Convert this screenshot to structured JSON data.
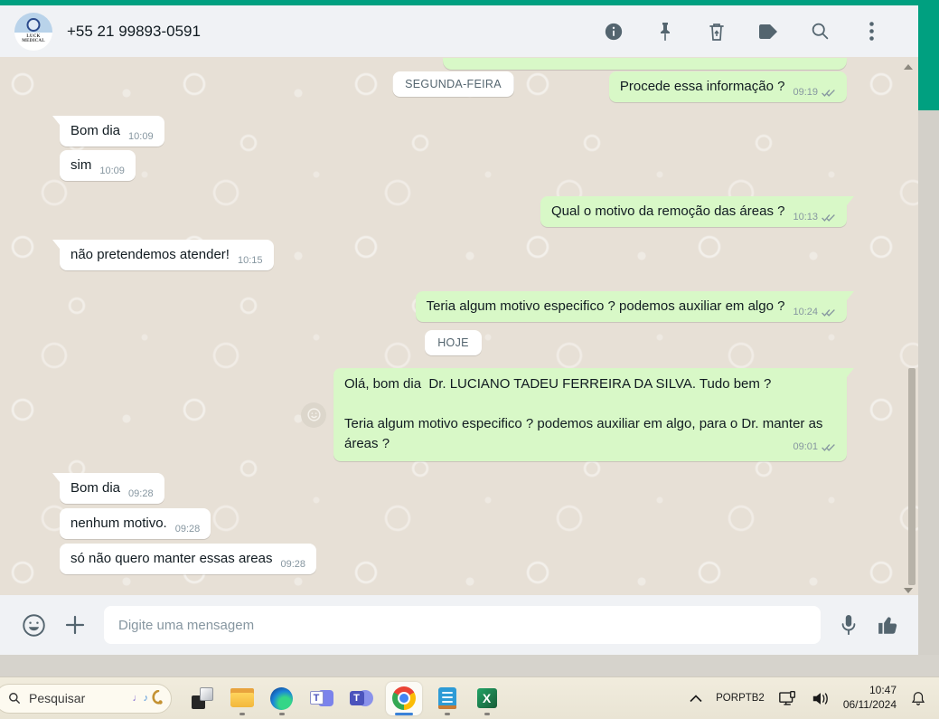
{
  "colors": {
    "accent_green": "#00a080",
    "bubble_outgoing": "#d8f8c7",
    "bubble_incoming": "#ffffff",
    "header_bg": "#f0f2f5",
    "chat_bg": "#e7e0d6",
    "taskbar_active_indicator": "#3b82d8"
  },
  "header": {
    "phone": "+55 21 99893-0591",
    "avatar_text": "LUCK MEDICAL"
  },
  "chat": {
    "messages": [
      {
        "kind": "partial-out"
      },
      {
        "kind": "out",
        "text": "Procede essa informação ?",
        "time": "09:19",
        "ticks": true,
        "divider_overlay": "SEGUNDA-FEIRA",
        "gap": 2
      },
      {
        "kind": "in",
        "text": "Bom dia",
        "time": "10:09",
        "tail": true,
        "gap": 15
      },
      {
        "kind": "in",
        "text": "sim",
        "time": "10:09",
        "gap": 4
      },
      {
        "kind": "out",
        "text": "Qual o motivo da remoção das áreas ?",
        "time": "10:13",
        "ticks": true,
        "tail": true,
        "gap": 17
      },
      {
        "kind": "in",
        "text": "não pretendemos atender!",
        "time": "10:15",
        "tail": true,
        "gap": 14
      },
      {
        "kind": "out",
        "text": "Teria algum motivo especifico ? podemos auxiliar em algo ?",
        "time": "10:24",
        "ticks": true,
        "tail": true,
        "gap": 23
      },
      {
        "kind": "divider",
        "text": "HOJE",
        "gap": 9
      },
      {
        "kind": "out",
        "text": "Olá, bom dia  Dr. LUCIANO TADEU FERREIRA DA SILVA. Tudo bem ?\n\nTeria algum motivo especifico ? podemos auxiliar em algo, para o Dr. manter as áreas ?",
        "time": "09:01",
        "ticks": true,
        "tail": true,
        "react": true,
        "wide": true,
        "gap": 14
      },
      {
        "kind": "in",
        "text": "Bom dia",
        "time": "09:28",
        "tail": true,
        "gap": 13
      },
      {
        "kind": "in",
        "text": "nenhum motivo.",
        "time": "09:28",
        "gap": 5
      },
      {
        "kind": "in",
        "text": "só não quero manter essas areas",
        "time": "09:28",
        "gap": 5
      }
    ]
  },
  "composer": {
    "placeholder": "Digite uma mensagem"
  },
  "taskbar": {
    "search_placeholder": "Pesquisar",
    "tray": {
      "lang_line1": "POR",
      "lang_line2": "PTB2",
      "time": "10:47",
      "date": "06/11/2024"
    }
  }
}
